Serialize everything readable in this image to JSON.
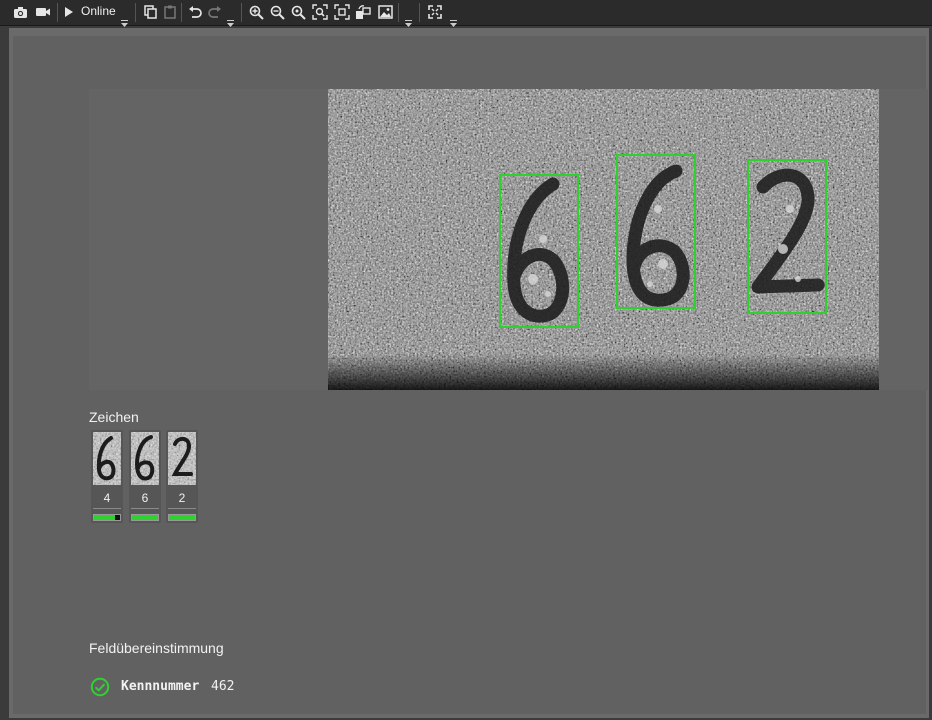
{
  "toolbar": {
    "online_label": "Online",
    "icons": [
      "camera-icon",
      "video-icon",
      "play-icon",
      "copy-icon",
      "paste-icon",
      "undo-icon",
      "redo-icon",
      "zoom-in-icon",
      "zoom-out-icon",
      "zoom-reset-icon",
      "zoom-fit-icon",
      "zoom-region-icon",
      "rotate-icon",
      "image-icon",
      "fullscreen-icon"
    ]
  },
  "image_view": {
    "detected_text": "462",
    "box_color": "#2ed12e"
  },
  "characters": {
    "title": "Zeichen",
    "items": [
      {
        "value": "4",
        "confidence": 0.82
      },
      {
        "value": "6",
        "confidence": 1.0
      },
      {
        "value": "2",
        "confidence": 1.0
      }
    ]
  },
  "field_match": {
    "title": "Feldübereinstimmung",
    "status_icon": "check-circle-icon",
    "status_color": "#2ed12e",
    "field_name": "Kennnummer",
    "field_value": "462"
  }
}
